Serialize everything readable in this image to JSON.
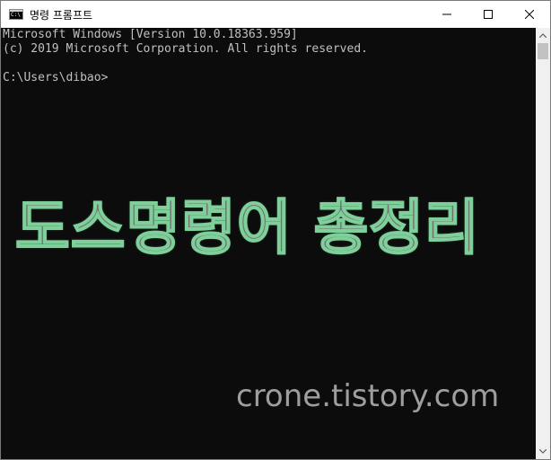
{
  "window": {
    "title": "명령 프롬프트",
    "icon": "console-icon",
    "controls": {
      "minimize": "minimize-icon",
      "maximize": "maximize-icon",
      "close": "close-icon"
    }
  },
  "console": {
    "lines": [
      "Microsoft Windows [Version 10.0.18363.959]",
      "(c) 2019 Microsoft Corporation. All rights reserved.",
      "",
      "C:\\Users\\dibao>"
    ]
  },
  "overlay": {
    "title": "도스명령어 총정리",
    "site": "crone.tistory.com"
  },
  "colors": {
    "console_background": "#0c0c0c",
    "console_text": "#c0c0c0",
    "overlay_fill": "#707070",
    "overlay_outline": "#7fcf9a",
    "site_text": "#9e9e9e"
  }
}
